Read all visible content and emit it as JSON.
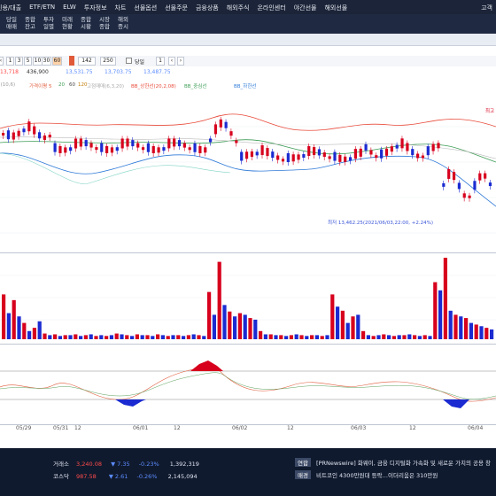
{
  "top_menu": {
    "items": [
      "신용/대출",
      "ETF/ETN",
      "ELW",
      "투자정보",
      "차트",
      "선물옵션",
      "선물주문",
      "금융상품",
      "해외주식",
      "온라인센터",
      "야간선물",
      "해외선물"
    ],
    "right_label": "고객"
  },
  "sub_menu": [
    {
      "line1": "당일",
      "line2": "매매"
    },
    {
      "line1": "종합",
      "line2": "잔고"
    },
    {
      "line1": "투자",
      "line2": "일별"
    },
    {
      "line1": "미래",
      "line2": "현황"
    },
    {
      "line1": "종합",
      "line2": "시황"
    },
    {
      "line1": "시장",
      "line2": "종합"
    },
    {
      "line1": "해외",
      "line2": "증시"
    }
  ],
  "toolbar": {
    "buttons": [
      "1",
      "3",
      "5",
      "10",
      "30",
      "60"
    ],
    "period_value": "142",
    "count_value": "250",
    "same_day_label": "당일",
    "page_value": "1"
  },
  "info_bar": {
    "val1": "13,718",
    "val2": "436,900",
    "val3": "13,531.75",
    "val4": "13,703.75",
    "val5": "13,487.75"
  },
  "legend": {
    "items": [
      "tail(10,6)",
      "가격이평 5",
      "20",
      "60",
      "120",
      "고점매매(6,3,20)",
      "BB_상한선(20,2,08)",
      "BB_중심선",
      "BB_하한선"
    ]
  },
  "chart_annotations": {
    "low_label": "최저 13,462.25(2021/06/03,22:00, +2.24%)",
    "high_label": "최고"
  },
  "date_axis": [
    "05/29",
    "05/31",
    "12",
    "06/01",
    "12",
    "06/02",
    "12",
    "06/03",
    "12",
    "06/04"
  ],
  "status_bar": {
    "row1": {
      "name": "거래소",
      "value": "3,240.08",
      "change": "▼ 7.35",
      "pct": "-0.23%",
      "volume": "1,392,319"
    },
    "row2": {
      "name": "코스닥",
      "value": "987.58",
      "change": "▼ 2.61",
      "pct": "-0.26%",
      "volume": "2,145,094"
    },
    "news1": {
      "badge": "연합",
      "text": "[PRNewswire] 화웨이, 금융 디지털화 가속화 및 새로운 가치의 공용 창"
    },
    "news2": {
      "badge": "매경",
      "text": "비트코인 4300만원대 등락…이더리움은 310만원"
    }
  },
  "colors": {
    "up": "#d7001d",
    "down": "#1b2bd1",
    "bb_upper": "#e84a3a",
    "bb_lower": "#2f7ad8",
    "ma": "#3c9c55",
    "header": "#1b2438"
  },
  "volume_series": [
    {
      "up": true,
      "v": 0.55
    },
    {
      "up": false,
      "v": 0.32
    },
    {
      "up": true,
      "v": 0.48
    },
    {
      "up": false,
      "v": 0.28
    },
    {
      "up": true,
      "v": 0.2
    },
    {
      "up": false,
      "v": 0.1
    },
    {
      "up": true,
      "v": 0.14
    },
    {
      "up": false,
      "v": 0.22
    },
    {
      "up": true,
      "v": 0.07
    },
    {
      "up": false,
      "v": 0.05
    },
    {
      "up": true,
      "v": 0.06
    },
    {
      "up": false,
      "v": 0.04
    },
    {
      "up": true,
      "v": 0.05
    },
    {
      "up": false,
      "v": 0.05
    },
    {
      "up": true,
      "v": 0.06
    },
    {
      "up": false,
      "v": 0.04
    },
    {
      "up": true,
      "v": 0.05
    },
    {
      "up": false,
      "v": 0.06
    },
    {
      "up": true,
      "v": 0.04
    },
    {
      "up": false,
      "v": 0.05
    },
    {
      "up": true,
      "v": 0.04
    },
    {
      "up": false,
      "v": 0.05
    },
    {
      "up": true,
      "v": 0.07
    },
    {
      "up": false,
      "v": 0.06
    },
    {
      "up": true,
      "v": 0.05
    },
    {
      "up": false,
      "v": 0.04
    },
    {
      "up": true,
      "v": 0.06
    },
    {
      "up": false,
      "v": 0.05
    },
    {
      "up": true,
      "v": 0.05
    },
    {
      "up": false,
      "v": 0.04
    },
    {
      "up": true,
      "v": 0.06
    },
    {
      "up": false,
      "v": 0.05
    },
    {
      "up": true,
      "v": 0.04
    },
    {
      "up": false,
      "v": 0.05
    },
    {
      "up": true,
      "v": 0.05
    },
    {
      "up": false,
      "v": 0.04
    },
    {
      "up": true,
      "v": 0.05
    },
    {
      "up": false,
      "v": 0.06
    },
    {
      "up": true,
      "v": 0.05
    },
    {
      "up": false,
      "v": 0.04
    },
    {
      "up": true,
      "v": 0.58
    },
    {
      "up": false,
      "v": 0.3
    },
    {
      "up": true,
      "v": 0.95
    },
    {
      "up": false,
      "v": 0.42
    },
    {
      "up": true,
      "v": 0.34
    },
    {
      "up": false,
      "v": 0.28
    },
    {
      "up": true,
      "v": 0.32
    },
    {
      "up": false,
      "v": 0.3
    },
    {
      "up": true,
      "v": 0.26
    },
    {
      "up": false,
      "v": 0.24
    },
    {
      "up": true,
      "v": 0.1
    },
    {
      "up": false,
      "v": 0.06
    },
    {
      "up": true,
      "v": 0.06
    },
    {
      "up": false,
      "v": 0.05
    },
    {
      "up": true,
      "v": 0.05
    },
    {
      "up": false,
      "v": 0.04
    },
    {
      "up": true,
      "v": 0.05
    },
    {
      "up": false,
      "v": 0.06
    },
    {
      "up": true,
      "v": 0.05
    },
    {
      "up": false,
      "v": 0.04
    },
    {
      "up": true,
      "v": 0.05
    },
    {
      "up": false,
      "v": 0.05
    },
    {
      "up": true,
      "v": 0.04
    },
    {
      "up": false,
      "v": 0.05
    },
    {
      "up": true,
      "v": 0.55
    },
    {
      "up": false,
      "v": 0.4
    },
    {
      "up": true,
      "v": 0.35
    },
    {
      "up": false,
      "v": 0.2
    },
    {
      "up": true,
      "v": 0.28
    },
    {
      "up": false,
      "v": 0.3
    },
    {
      "up": true,
      "v": 0.1
    },
    {
      "up": false,
      "v": 0.05
    },
    {
      "up": true,
      "v": 0.04
    },
    {
      "up": false,
      "v": 0.05
    },
    {
      "up": true,
      "v": 0.06
    },
    {
      "up": false,
      "v": 0.05
    },
    {
      "up": true,
      "v": 0.04
    },
    {
      "up": false,
      "v": 0.05
    },
    {
      "up": true,
      "v": 0.05
    },
    {
      "up": false,
      "v": 0.06
    },
    {
      "up": true,
      "v": 0.05
    },
    {
      "up": false,
      "v": 0.04
    },
    {
      "up": true,
      "v": 0.05
    },
    {
      "up": false,
      "v": 0.04
    },
    {
      "up": true,
      "v": 0.7
    },
    {
      "up": false,
      "v": 0.6
    },
    {
      "up": true,
      "v": 1.0
    },
    {
      "up": false,
      "v": 0.35
    },
    {
      "up": true,
      "v": 0.3
    },
    {
      "up": false,
      "v": 0.28
    },
    {
      "up": true,
      "v": 0.26
    },
    {
      "up": false,
      "v": 0.2
    },
    {
      "up": true,
      "v": 0.18
    },
    {
      "up": false,
      "v": 0.16
    },
    {
      "up": true,
      "v": 0.14
    },
    {
      "up": false,
      "v": 0.12
    }
  ]
}
